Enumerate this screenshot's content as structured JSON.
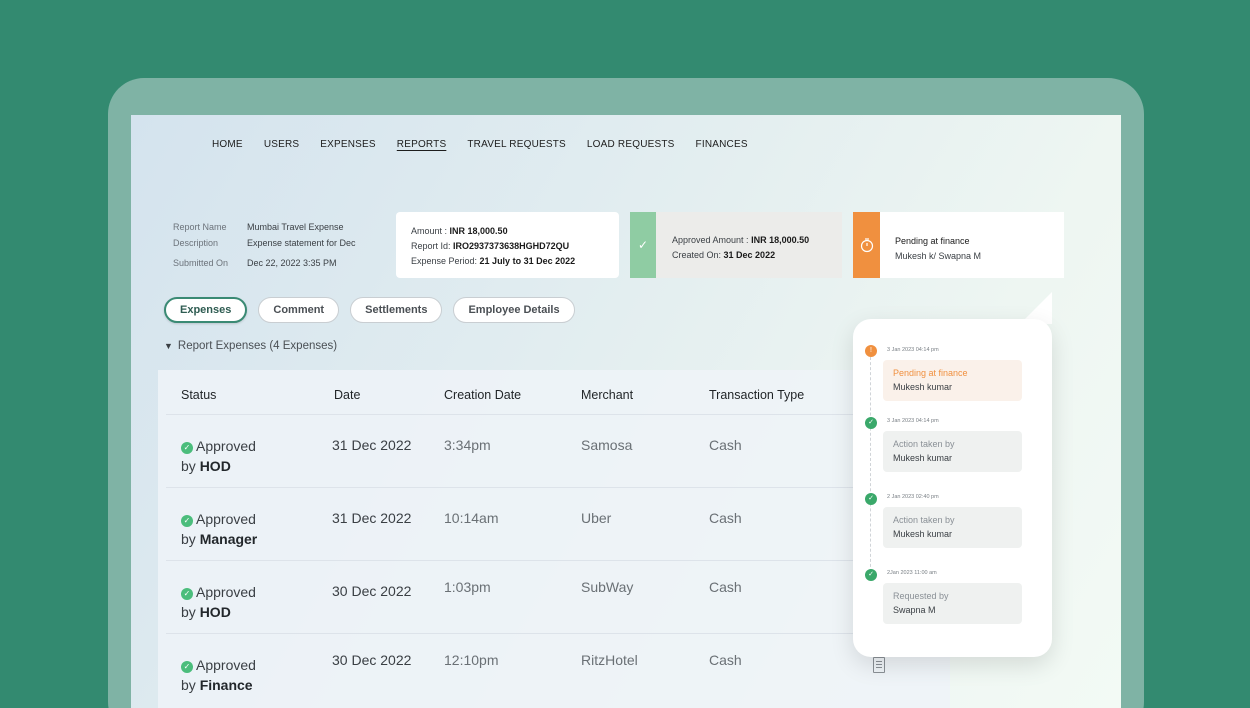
{
  "nav": {
    "items": [
      "HOME",
      "USERS",
      "EXPENSES",
      "REPORTS",
      "TRAVEL REQUESTS",
      "LOAD REQUESTS",
      "FINANCES"
    ],
    "active": "REPORTS"
  },
  "report": {
    "name_label": "Report Name",
    "name": "Mumbai Travel Expense",
    "description_label": "Description",
    "description": "Expense statement for Dec",
    "submitted_label": "Submitted On",
    "submitted": "Dec 22, 2022 3:35 PM"
  },
  "amount_card": {
    "amount_label": "Amount : ",
    "amount": "INR 18,000.50",
    "report_id_label": "Report Id: ",
    "report_id": "IRO2937373638HGHD72QU",
    "period_label": "Expense Period: ",
    "period": "21 July to 31 Dec 2022"
  },
  "approved_card": {
    "amount_label": "Approved Amount : ",
    "amount": "INR 18,000.50",
    "created_label": "Created On: ",
    "created": "31 Dec  2022",
    "icon": "check-icon"
  },
  "pending_card": {
    "status": "Pending at finance",
    "people": "Mukesh k/ Swapna M",
    "icon": "timer-icon"
  },
  "tabs": [
    "Expenses",
    "Comment",
    "Settlements",
    "Employee Details"
  ],
  "active_tab": "Expenses",
  "section": {
    "title": "Report Expenses (4 Expenses)"
  },
  "table": {
    "headers": [
      "Status",
      "Date",
      "Creation Date",
      "Merchant",
      "Transaction Type"
    ],
    "rows": [
      {
        "status": "Approved",
        "by_prefix": "by ",
        "by": "HOD",
        "date": "31 Dec 2022",
        "created": "3:34pm",
        "merchant": "Samosa",
        "type": "Cash"
      },
      {
        "status": "Approved",
        "by_prefix": "by ",
        "by": "Manager",
        "date": "31 Dec 2022",
        "created": "10:14am",
        "merchant": "Uber",
        "type": "Cash"
      },
      {
        "status": "Approved",
        "by_prefix": "by ",
        "by": "HOD",
        "date": "30 Dec 2022",
        "created": "1:03pm",
        "merchant": "SubWay",
        "type": "Cash"
      },
      {
        "status": "Approved",
        "by_prefix": "by ",
        "by": "Finance",
        "date": "30 Dec 2022",
        "created": "12:10pm",
        "merchant": "RitzHotel",
        "type": "Cash"
      }
    ]
  },
  "timeline": [
    {
      "time": "3 Jan 2023  04:14 pm",
      "title": "Pending at finance",
      "person": "Mukesh kumar",
      "state": "pending"
    },
    {
      "time": "3 Jan 2023  04:14 pm",
      "title": "Action taken by",
      "person": "Mukesh kumar",
      "state": "done"
    },
    {
      "time": "2 Jan 2023  02:40 pm",
      "title": "Action taken by",
      "person": "Mukesh kumar",
      "state": "done"
    },
    {
      "time": "2Jan 2023  11:00 am",
      "title": "Requested by",
      "person": "Swapna M",
      "state": "done"
    }
  ],
  "colors": {
    "background": "#338a70",
    "accent": "#3a8a74",
    "approved": "#4bbd7c",
    "pending": "#f0903f"
  }
}
